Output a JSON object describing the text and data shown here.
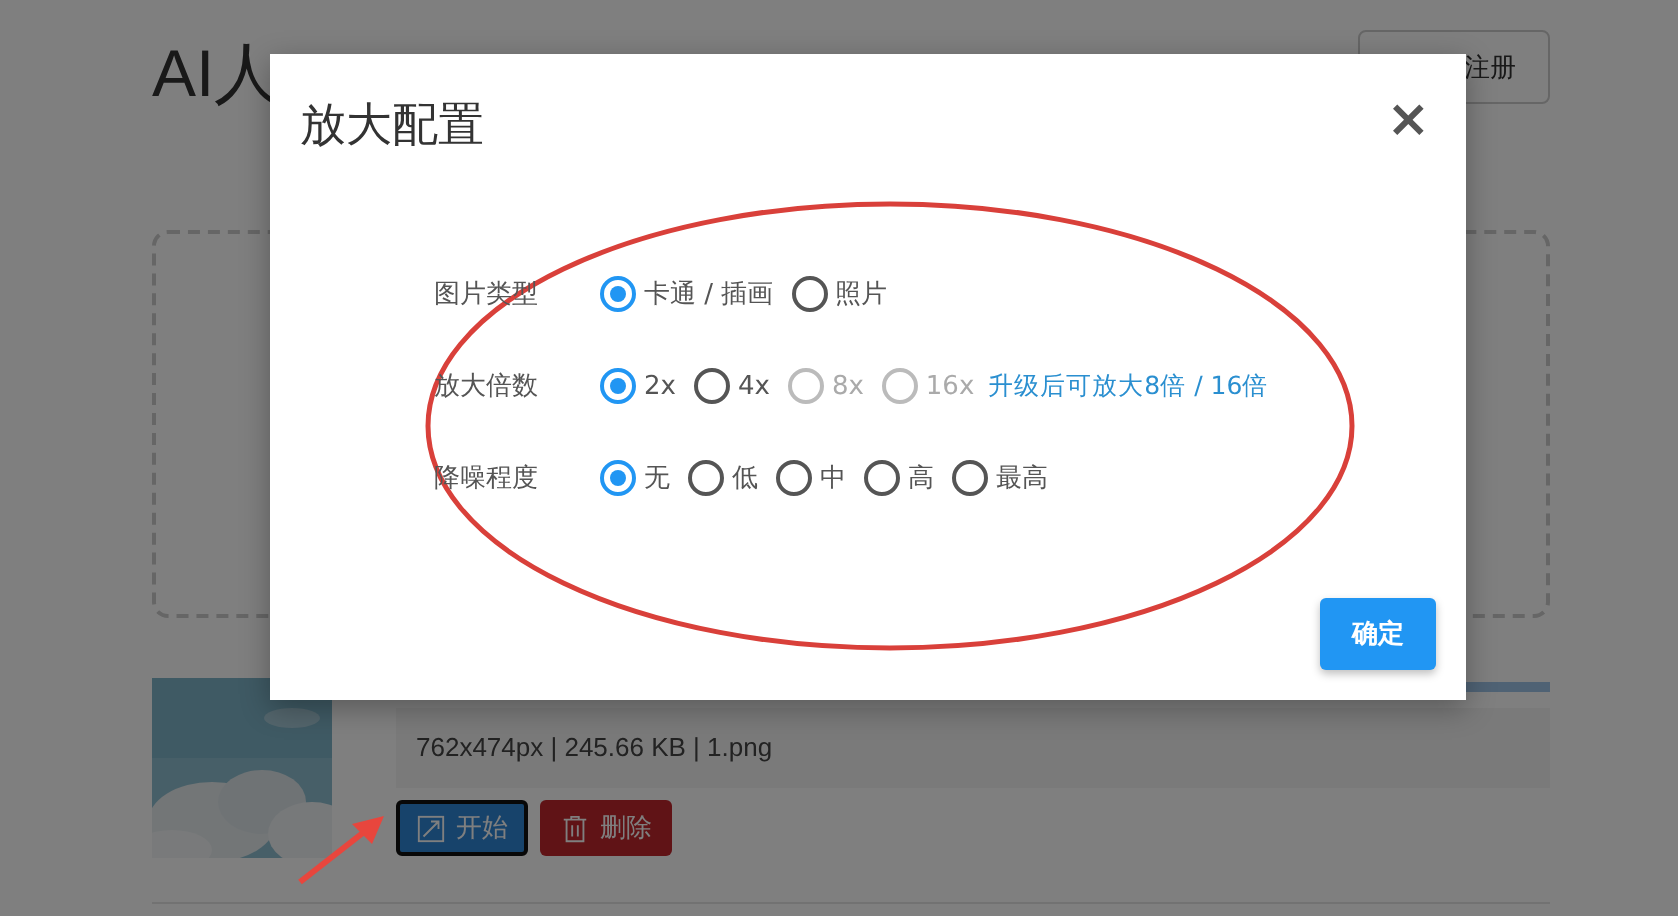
{
  "page": {
    "title": "AI人",
    "account_button": "注册",
    "file": {
      "info": "762x474px | 245.66 KB | 1.png",
      "level": 1,
      "actions": [
        {
          "kind": "start",
          "label": "开始",
          "focused": true
        },
        {
          "kind": "delete",
          "label": "删除",
          "focused": false
        }
      ]
    }
  },
  "dialog": {
    "title": "放大配置",
    "close": "×",
    "rows": [
      {
        "label": "图片类型",
        "options": [
          {
            "label": "卡通 / 插画",
            "selected": true,
            "disabled": false
          },
          {
            "label": "照片",
            "selected": false,
            "disabled": false
          }
        ]
      },
      {
        "label": "放大倍数",
        "options": [
          {
            "label": "2x",
            "selected": true,
            "disabled": false
          },
          {
            "label": "4x",
            "selected": false,
            "disabled": false
          },
          {
            "label": "8x",
            "selected": false,
            "disabled": true
          },
          {
            "label": "16x",
            "selected": false,
            "disabled": true
          }
        ],
        "note": "升级后可放大8倍 / 16倍"
      },
      {
        "label": "降噪程度",
        "options": [
          {
            "label": "无",
            "selected": true,
            "disabled": false
          },
          {
            "label": "低",
            "selected": false,
            "disabled": false
          },
          {
            "label": "中",
            "selected": false,
            "disabled": false
          },
          {
            "label": "高",
            "selected": false,
            "disabled": false
          },
          {
            "label": "最高",
            "selected": false,
            "disabled": false
          }
        ]
      }
    ],
    "confirm": "确定"
  }
}
